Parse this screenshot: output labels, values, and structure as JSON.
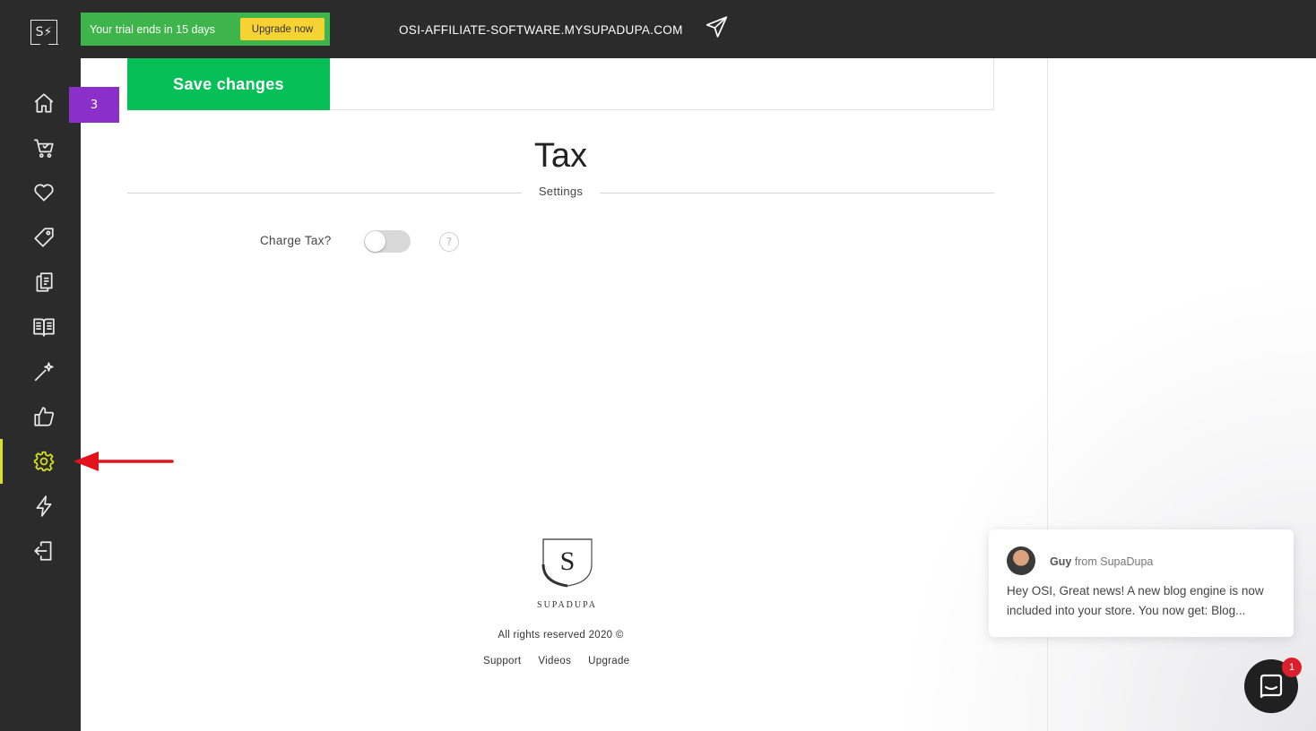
{
  "app": {
    "logo_text": "S⚡"
  },
  "topbar": {
    "trial_text": "Your trial ends in 15 days",
    "upgrade_label": "Upgrade now",
    "domain": "OSI-AFFILIATE-SOFTWARE.MYSUPADUPA.COM",
    "send_icon": "paper-plane-icon"
  },
  "sidebar": {
    "active_color": "#d9e021",
    "items": [
      {
        "name": "home",
        "icon": "home-icon"
      },
      {
        "name": "cart",
        "icon": "cart-icon"
      },
      {
        "name": "favorites",
        "icon": "heart-icon"
      },
      {
        "name": "tags",
        "icon": "tag-icon"
      },
      {
        "name": "pages",
        "icon": "pages-icon"
      },
      {
        "name": "blog",
        "icon": "book-icon"
      },
      {
        "name": "design",
        "icon": "magic-wand-icon"
      },
      {
        "name": "social",
        "icon": "thumbs-up-icon"
      },
      {
        "name": "settings",
        "icon": "gear-icon",
        "active": true
      },
      {
        "name": "apps",
        "icon": "lightning-icon"
      },
      {
        "name": "logout",
        "icon": "logout-icon"
      }
    ]
  },
  "tour_badge": "3",
  "save_label": "Save changes",
  "tax": {
    "title": "Tax",
    "subtitle": "Settings",
    "charge_label": "Charge Tax?",
    "charge_enabled": false,
    "help_glyph": "?"
  },
  "footer": {
    "logo_letter": "S",
    "brand": "SUPADUPA",
    "rights": "All rights reserved 2020 ©",
    "links": [
      "Support",
      "Videos",
      "Upgrade"
    ]
  },
  "chat": {
    "agent": "Guy",
    "from_suffix": "from SupaDupa",
    "message": "Hey OSI, Great news! A new blog engine is now included into your store.  You now get: Blog...",
    "unread": "1"
  },
  "colors": {
    "sidebar_bg": "#2b2b2b",
    "trial_bg": "#3eb54a",
    "upgrade_bg": "#f7d233",
    "save_bg": "#06bf57",
    "badge_bg": "#8b2fc9",
    "arrow": "#e3131b"
  }
}
